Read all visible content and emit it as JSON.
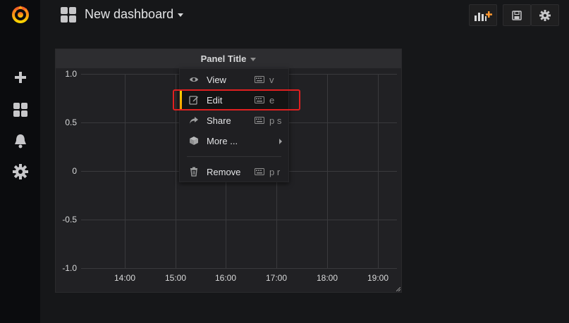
{
  "topnav": {
    "title": "New dashboard",
    "icons": [
      "dashboard-grid-icon",
      "add-panel-icon",
      "save-icon",
      "settings-icon"
    ]
  },
  "sidemenu": {
    "items": [
      "grafana-logo",
      "plus-icon",
      "dashboards-icon",
      "alerting-bell-icon",
      "configuration-gear-icon"
    ]
  },
  "panel": {
    "title": "Panel Title",
    "y_ticks": [
      "1.0",
      "0.5",
      "0",
      "-0.5",
      "-1.0"
    ],
    "x_ticks": [
      "14:00",
      "15:00",
      "16:00",
      "17:00",
      "18:00",
      "19:00"
    ]
  },
  "menu": {
    "items": [
      {
        "label": "View",
        "shortcut": "v",
        "icon": "eye-icon"
      },
      {
        "label": "Edit",
        "shortcut": "e",
        "icon": "edit-icon"
      },
      {
        "label": "Share",
        "shortcut": "p s",
        "icon": "share-icon"
      },
      {
        "label": "More ...",
        "shortcut": "",
        "icon": "cube-icon"
      },
      {
        "label": "Remove",
        "shortcut": "p r",
        "icon": "trash-icon"
      }
    ]
  },
  "colors": {
    "accent": "#ff9830",
    "highlight_border": "#e02020",
    "background": "#161719",
    "panel_bg": "#212124"
  }
}
